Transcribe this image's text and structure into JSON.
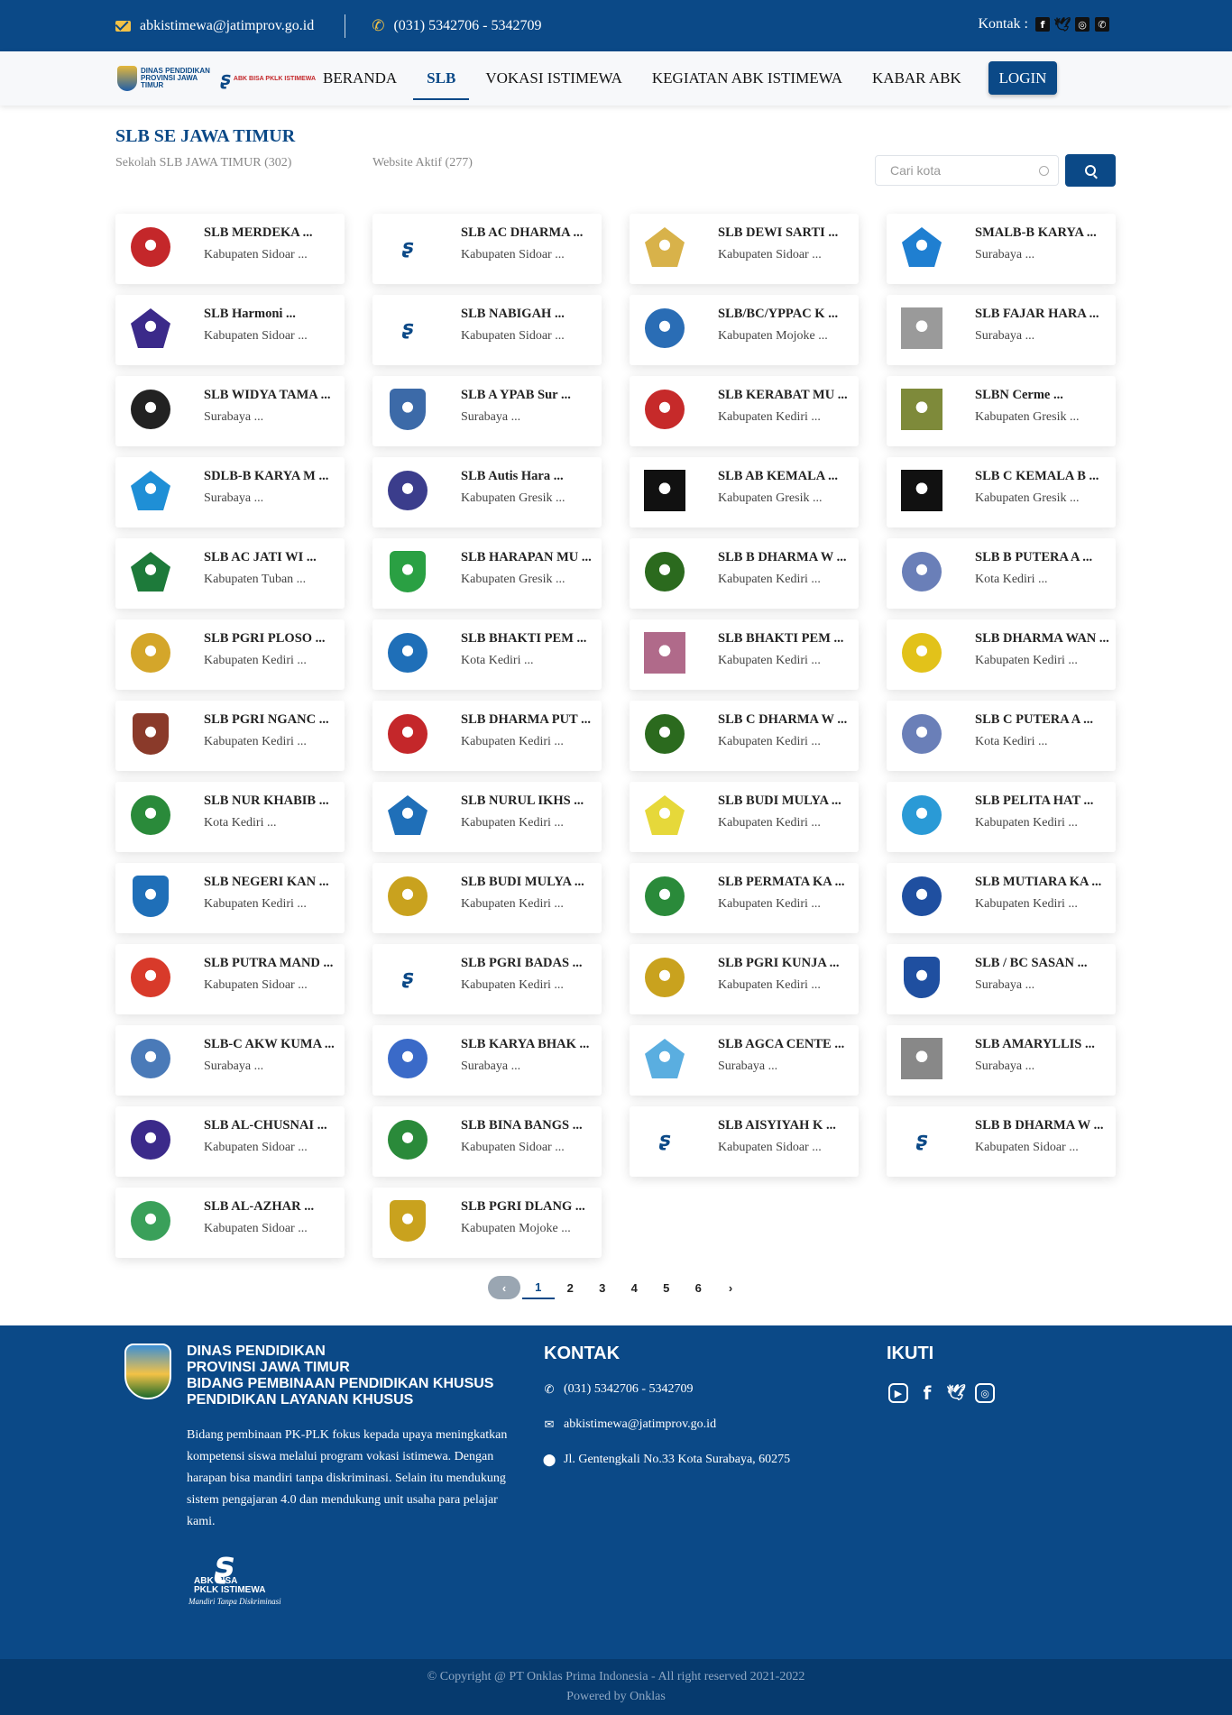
{
  "topbar": {
    "email": "abkistimewa@jatimprov.go.id",
    "phone": "(031) 5342706 - 5342709",
    "kontak_label": "Kontak :",
    "social": [
      "facebook-icon",
      "twitter-icon",
      "instagram-icon",
      "whatsapp-icon"
    ]
  },
  "nav": {
    "logo_text": "DINAS PENDIDIKAN PROVINSI JAWA TIMUR",
    "logo_abk": "ABK BISA PKLK ISTIMEWA",
    "items": [
      "BERANDA",
      "SLB",
      "VOKASI ISTIMEWA",
      "KEGIATAN ABK ISTIMEWA",
      "KABAR ABK"
    ],
    "active": "SLB",
    "login": "LOGIN"
  },
  "section": {
    "title": "SLB SE JAWA TIMUR",
    "count_label": "Sekolah SLB JAWA TIMUR (302)",
    "active_label": "Website Aktif (277)",
    "search_placeholder": "Cari kota"
  },
  "schools": [
    {
      "name": "SLB MERDEKA ...",
      "loc": "Kabupaten Sidoar ...",
      "color": "#c4272a",
      "shape": "circle"
    },
    {
      "name": "SLB AC DHARMA ...",
      "loc": "Kabupaten Sidoar ...",
      "color": "#0b4987",
      "shape": "abk"
    },
    {
      "name": "SLB DEWI SARTI ...",
      "loc": "Kabupaten Sidoar ...",
      "color": "#d8b24a",
      "shape": "pent"
    },
    {
      "name": "SMALB-B KARYA ...",
      "loc": "Surabaya ...",
      "color": "#1f7fd1",
      "shape": "pent"
    },
    {
      "name": "SLB Harmoni ...",
      "loc": "Kabupaten Sidoar ...",
      "color": "#3b2a8a",
      "shape": "pent"
    },
    {
      "name": "SLB NABIGAH ...",
      "loc": "Kabupaten Sidoar ...",
      "color": "#0b4987",
      "shape": "abk"
    },
    {
      "name": "SLB/BC/YPPAC K ...",
      "loc": "Kabupaten Mojoke ...",
      "color": "#2a6db5",
      "shape": "circle"
    },
    {
      "name": "SLB FAJAR HARA ...",
      "loc": "Surabaya ...",
      "color": "#9a9a9a",
      "shape": "square"
    },
    {
      "name": "SLB WIDYA TAMA ...",
      "loc": "Surabaya ...",
      "color": "#222222",
      "shape": "circle"
    },
    {
      "name": "SLB A YPAB Sur ...",
      "loc": "Surabaya ...",
      "color": "#3c6aa8",
      "shape": "shield"
    },
    {
      "name": "SLB KERABAT MU ...",
      "loc": "Kabupaten Kediri ...",
      "color": "#c62a2a",
      "shape": "circle"
    },
    {
      "name": "SLBN Cerme ...",
      "loc": "Kabupaten Gresik ...",
      "color": "#7e8a3a",
      "shape": "square"
    },
    {
      "name": "SDLB-B KARYA M ...",
      "loc": "Surabaya ...",
      "color": "#1f8fd6",
      "shape": "pent"
    },
    {
      "name": "SLB Autis Hara ...",
      "loc": "Kabupaten Gresik ...",
      "color": "#3b3d8c",
      "shape": "circle"
    },
    {
      "name": "SLB AB KEMALA ...",
      "loc": "Kabupaten Gresik ...",
      "color": "#111111",
      "shape": "square"
    },
    {
      "name": "SLB C KEMALA B ...",
      "loc": "Kabupaten Gresik ...",
      "color": "#111111",
      "shape": "square"
    },
    {
      "name": "SLB AC JATI WI ...",
      "loc": "Kabupaten Tuban ...",
      "color": "#1d7a3a",
      "shape": "pent"
    },
    {
      "name": "SLB HARAPAN MU ...",
      "loc": "Kabupaten Gresik ...",
      "color": "#2aa043",
      "shape": "shield"
    },
    {
      "name": "SLB B DHARMA W ...",
      "loc": "Kabupaten Kediri ...",
      "color": "#2b6a1e",
      "shape": "circle"
    },
    {
      "name": "SLB B PUTERA A ...",
      "loc": "Kota Kediri ...",
      "color": "#6a7fb8",
      "shape": "circle"
    },
    {
      "name": "SLB PGRI PLOSO ...",
      "loc": "Kabupaten Kediri ...",
      "color": "#d4a62a",
      "shape": "circle"
    },
    {
      "name": "SLB BHAKTI PEM ...",
      "loc": "Kota Kediri ...",
      "color": "#1f6fb8",
      "shape": "circle"
    },
    {
      "name": "SLB BHAKTI PEM ...",
      "loc": "Kabupaten Kediri ...",
      "color": "#b06a8a",
      "shape": "square"
    },
    {
      "name": "SLB DHARMA WAN ...",
      "loc": "Kabupaten Kediri ...",
      "color": "#e2c21a",
      "shape": "circle"
    },
    {
      "name": "SLB PGRI NGANC ...",
      "loc": "Kabupaten Kediri ...",
      "color": "#8a3a2a",
      "shape": "shield"
    },
    {
      "name": "SLB DHARMA PUT ...",
      "loc": "Kabupaten Kediri ...",
      "color": "#c4272a",
      "shape": "circle"
    },
    {
      "name": "SLB C DHARMA W ...",
      "loc": "Kabupaten Kediri ...",
      "color": "#2b6a1e",
      "shape": "circle"
    },
    {
      "name": "SLB C PUTERA A ...",
      "loc": "Kota Kediri ...",
      "color": "#6a7fb8",
      "shape": "circle"
    },
    {
      "name": "SLB NUR KHABIB ...",
      "loc": "Kota Kediri ...",
      "color": "#2a8a3a",
      "shape": "circle"
    },
    {
      "name": "SLB NURUL IKHS ...",
      "loc": "Kabupaten Kediri ...",
      "color": "#1f6fb8",
      "shape": "pent"
    },
    {
      "name": "SLB BUDI MULYA ...",
      "loc": "Kabupaten Kediri ...",
      "color": "#e6d83a",
      "shape": "pent"
    },
    {
      "name": "SLB PELITA HAT ...",
      "loc": "Kabupaten Kediri ...",
      "color": "#2a9ad6",
      "shape": "circle"
    },
    {
      "name": "SLB NEGERI KAN ...",
      "loc": "Kabupaten Kediri ...",
      "color": "#1f6fb8",
      "shape": "shield"
    },
    {
      "name": "SLB BUDI MULYA ...",
      "loc": "Kabupaten Kediri ...",
      "color": "#c9a21e",
      "shape": "circle"
    },
    {
      "name": "SLB PERMATA KA ...",
      "loc": "Kabupaten Kediri ...",
      "color": "#2a8a3a",
      "shape": "circle"
    },
    {
      "name": "SLB MUTIARA KA ...",
      "loc": "Kabupaten Kediri ...",
      "color": "#1f4fa0",
      "shape": "circle"
    },
    {
      "name": "SLB PUTRA MAND ...",
      "loc": "Kabupaten Sidoar ...",
      "color": "#d83a2a",
      "shape": "circle"
    },
    {
      "name": "SLB PGRI BADAS ...",
      "loc": "Kabupaten Kediri ...",
      "color": "#0b4987",
      "shape": "abk"
    },
    {
      "name": "SLB PGRI KUNJA ...",
      "loc": "Kabupaten Kediri ...",
      "color": "#c9a21e",
      "shape": "circle"
    },
    {
      "name": "SLB / BC SASAN ...",
      "loc": "Surabaya ...",
      "color": "#1f4fa0",
      "shape": "shield"
    },
    {
      "name": "SLB-C AKW KUMA ...",
      "loc": "Surabaya ...",
      "color": "#4a7ab8",
      "shape": "circle"
    },
    {
      "name": "SLB KARYA BHAK ...",
      "loc": "Surabaya ...",
      "color": "#3a6ac8",
      "shape": "circle"
    },
    {
      "name": "SLB AGCA CENTE ...",
      "loc": "Surabaya ...",
      "color": "#5aaee0",
      "shape": "pent"
    },
    {
      "name": "SLB AMARYLLIS ...",
      "loc": "Surabaya ...",
      "color": "#888888",
      "shape": "square"
    },
    {
      "name": "SLB AL-CHUSNAI ...",
      "loc": "Kabupaten Sidoar ...",
      "color": "#3b2a8a",
      "shape": "circle"
    },
    {
      "name": "SLB BINA BANGS ...",
      "loc": "Kabupaten Sidoar ...",
      "color": "#2a8a3a",
      "shape": "circle"
    },
    {
      "name": "SLB AISYIYAH K ...",
      "loc": "Kabupaten Sidoar ...",
      "color": "#0b4987",
      "shape": "abk"
    },
    {
      "name": "SLB B DHARMA W ...",
      "loc": "Kabupaten Sidoar ...",
      "color": "#0b4987",
      "shape": "abk"
    },
    {
      "name": "SLB AL-AZHAR ...",
      "loc": "Kabupaten Sidoar ...",
      "color": "#3aa05a",
      "shape": "circle"
    },
    {
      "name": "SLB PGRI DLANG ...",
      "loc": "Kabupaten Mojoke ...",
      "color": "#c9a21e",
      "shape": "shield"
    }
  ],
  "pagination": {
    "prev": "‹",
    "pages": [
      "1",
      "2",
      "3",
      "4",
      "5",
      "6"
    ],
    "active": "1",
    "next": "›"
  },
  "footer": {
    "org_line1": "DINAS PENDIDIKAN",
    "org_line2": "PROVINSI JAWA TIMUR",
    "org_line3": "BIDANG PEMBINAAN PENDIDIKAN KHUSUS",
    "org_line4": "PENDIDIKAN LAYANAN KHUSUS",
    "description": "Bidang pembinaan PK-PLK fokus kepada upaya meningkatkan kompetensi siswa melalui program vokasi istimewa. Dengan harapan bisa mandiri tanpa diskriminasi. Selain itu mendukung sistem pengajaran 4.0 dan mendukung unit usaha para pelajar kami.",
    "abk_line1": "ABK BISA",
    "abk_line2": "PKLK ISTIMEWA",
    "abk_tagline": "Mandiri Tanpa Diskriminasi",
    "kontak_title": "KONTAK",
    "phone": "(031) 5342706 - 5342709",
    "email": "abkistimewa@jatimprov.go.id",
    "address": "Jl. Gentengkali No.33 Kota Surabaya, 60275",
    "ikuti_title": "IKUTI",
    "social": [
      "youtube-icon",
      "facebook-icon",
      "twitter-icon",
      "instagram-icon"
    ]
  },
  "copyright": {
    "line1": "© Copyright @ PT Onklas Prima Indonesia - All right reserved 2021-2022",
    "line2": "Powered by Onklas"
  }
}
